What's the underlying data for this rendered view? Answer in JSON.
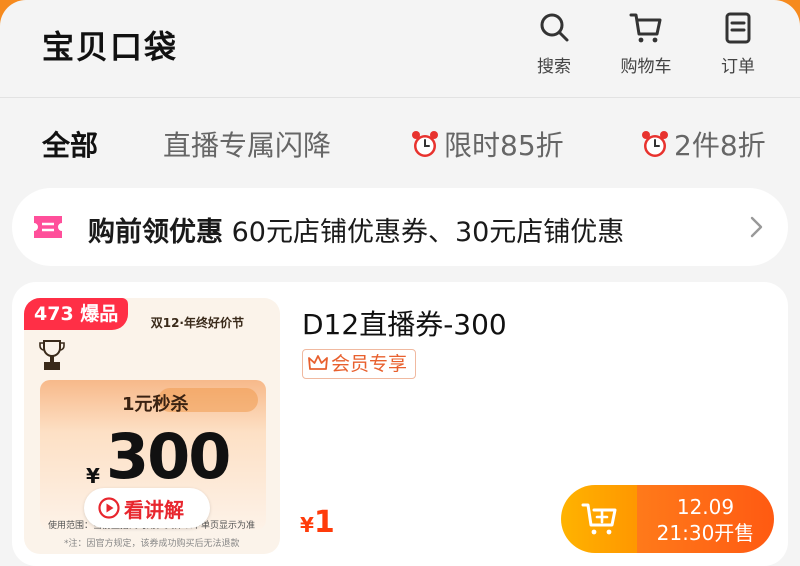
{
  "header": {
    "title": "宝贝口袋",
    "actions": [
      {
        "label": "搜索",
        "icon": "search-icon"
      },
      {
        "label": "购物车",
        "icon": "cart-icon"
      },
      {
        "label": "订单",
        "icon": "order-icon"
      }
    ]
  },
  "tabs": [
    {
      "label": "全部",
      "active": true
    },
    {
      "label": "直播专属闪降",
      "active": false
    },
    {
      "label": "限时85折",
      "icon": "alarm-clock-icon",
      "active": false
    },
    {
      "label": "2件8折",
      "icon": "alarm-clock-icon",
      "active": false
    }
  ],
  "promo": {
    "icon": "coupon-icon",
    "lead": "购前领优惠",
    "detail": "60元店铺优惠券、30元店铺优惠"
  },
  "product": {
    "badge": "473 爆品",
    "image": {
      "banner": "双12·年终好价节",
      "headline": "1元秒杀",
      "currency": "¥",
      "amount": "300",
      "usage_note": "使用范围：当前直播间可用，具体以下单页显示为准",
      "footnote": "*注：因官方规定，该券成功购买后无法退款",
      "watch_label": "看讲解"
    },
    "title": "D12直播券-300",
    "tag": "会员专享",
    "price_symbol": "¥",
    "price": "1",
    "sale_date": "12.09",
    "sale_time": "21:30开售"
  },
  "colors": {
    "accent_orange": "#ff5a12",
    "badge_red": "#ff2f46",
    "price_red": "#ff3b0a",
    "cart_yellow": "#ffb300"
  }
}
